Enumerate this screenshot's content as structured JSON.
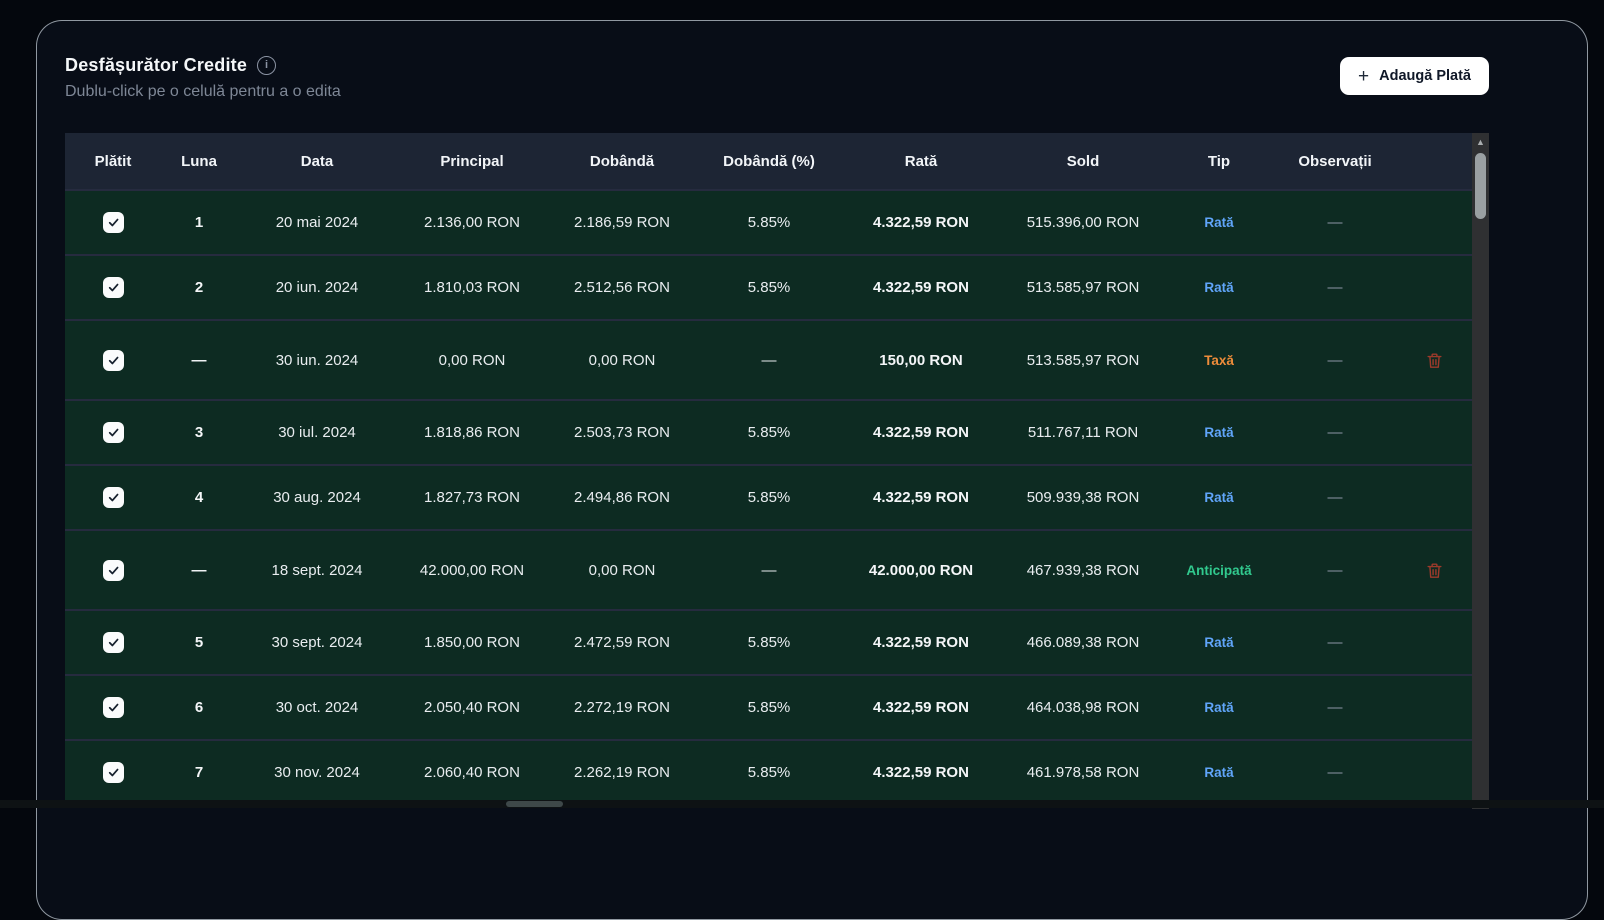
{
  "header": {
    "title": "Desfășurător Credite",
    "subtitle": "Dublu-click pe o celulă pentru a o edita",
    "info_icon_glyph": "i",
    "add_button": {
      "icon": "+",
      "label": "Adaugă Plată"
    }
  },
  "colors": {
    "accent_button_bg": "#ffffff",
    "header_bg": "#1d2534",
    "row_paid_bg": "#0d2b22",
    "tip_rata": "#60a5fa",
    "tip_taxa": "#ee8c3a",
    "tip_anticipata": "#31c98e",
    "delete_icon": "#9c3a2b"
  },
  "scrollbar": {
    "up_glyph": "▲"
  },
  "table": {
    "columns": [
      "Plătit",
      "Luna",
      "Data",
      "Principal",
      "Dobândă",
      "Dobândă (%)",
      "Rată",
      "Sold",
      "Tip",
      "Observații",
      ""
    ],
    "rows": [
      {
        "paid": true,
        "luna": "1",
        "data": "20 mai 2024",
        "principal": "2.136,00 RON",
        "dobanda": "2.186,59 RON",
        "dobanda_pct": "5.85%",
        "rata": "4.322,59 RON",
        "sold": "515.396,00 RON",
        "tip": "Rată",
        "tip_type": "rata",
        "observatii": "—",
        "deletable": false
      },
      {
        "paid": true,
        "luna": "2",
        "data": "20 iun. 2024",
        "principal": "1.810,03 RON",
        "dobanda": "2.512,56 RON",
        "dobanda_pct": "5.85%",
        "rata": "4.322,59 RON",
        "sold": "513.585,97 RON",
        "tip": "Rată",
        "tip_type": "rata",
        "observatii": "—",
        "deletable": false
      },
      {
        "paid": true,
        "luna": "—",
        "data": "30 iun. 2024",
        "principal": "0,00 RON",
        "dobanda": "0,00 RON",
        "dobanda_pct": "—",
        "rata": "150,00 RON",
        "sold": "513.585,97 RON",
        "tip": "Taxă",
        "tip_type": "taxa",
        "observatii": "—",
        "deletable": true
      },
      {
        "paid": true,
        "luna": "3",
        "data": "30 iul. 2024",
        "principal": "1.818,86 RON",
        "dobanda": "2.503,73 RON",
        "dobanda_pct": "5.85%",
        "rata": "4.322,59 RON",
        "sold": "511.767,11 RON",
        "tip": "Rată",
        "tip_type": "rata",
        "observatii": "—",
        "deletable": false
      },
      {
        "paid": true,
        "luna": "4",
        "data": "30 aug. 2024",
        "principal": "1.827,73 RON",
        "dobanda": "2.494,86 RON",
        "dobanda_pct": "5.85%",
        "rata": "4.322,59 RON",
        "sold": "509.939,38 RON",
        "tip": "Rată",
        "tip_type": "rata",
        "observatii": "—",
        "deletable": false
      },
      {
        "paid": true,
        "luna": "—",
        "data": "18 sept. 2024",
        "principal": "42.000,00 RON",
        "dobanda": "0,00 RON",
        "dobanda_pct": "—",
        "rata": "42.000,00 RON",
        "sold": "467.939,38 RON",
        "tip": "Anticipată",
        "tip_type": "anticipata",
        "observatii": "—",
        "deletable": true
      },
      {
        "paid": true,
        "luna": "5",
        "data": "30 sept. 2024",
        "principal": "1.850,00 RON",
        "dobanda": "2.472,59 RON",
        "dobanda_pct": "5.85%",
        "rata": "4.322,59 RON",
        "sold": "466.089,38 RON",
        "tip": "Rată",
        "tip_type": "rata",
        "observatii": "—",
        "deletable": false
      },
      {
        "paid": true,
        "luna": "6",
        "data": "30 oct. 2024",
        "principal": "2.050,40 RON",
        "dobanda": "2.272,19 RON",
        "dobanda_pct": "5.85%",
        "rata": "4.322,59 RON",
        "sold": "464.038,98 RON",
        "tip": "Rată",
        "tip_type": "rata",
        "observatii": "—",
        "deletable": false
      },
      {
        "paid": true,
        "luna": "7",
        "data": "30 nov. 2024",
        "principal": "2.060,40 RON",
        "dobanda": "2.262,19 RON",
        "dobanda_pct": "5.85%",
        "rata": "4.322,59 RON",
        "sold": "461.978,58 RON",
        "tip": "Rată",
        "tip_type": "rata",
        "observatii": "—",
        "deletable": false
      }
    ]
  }
}
